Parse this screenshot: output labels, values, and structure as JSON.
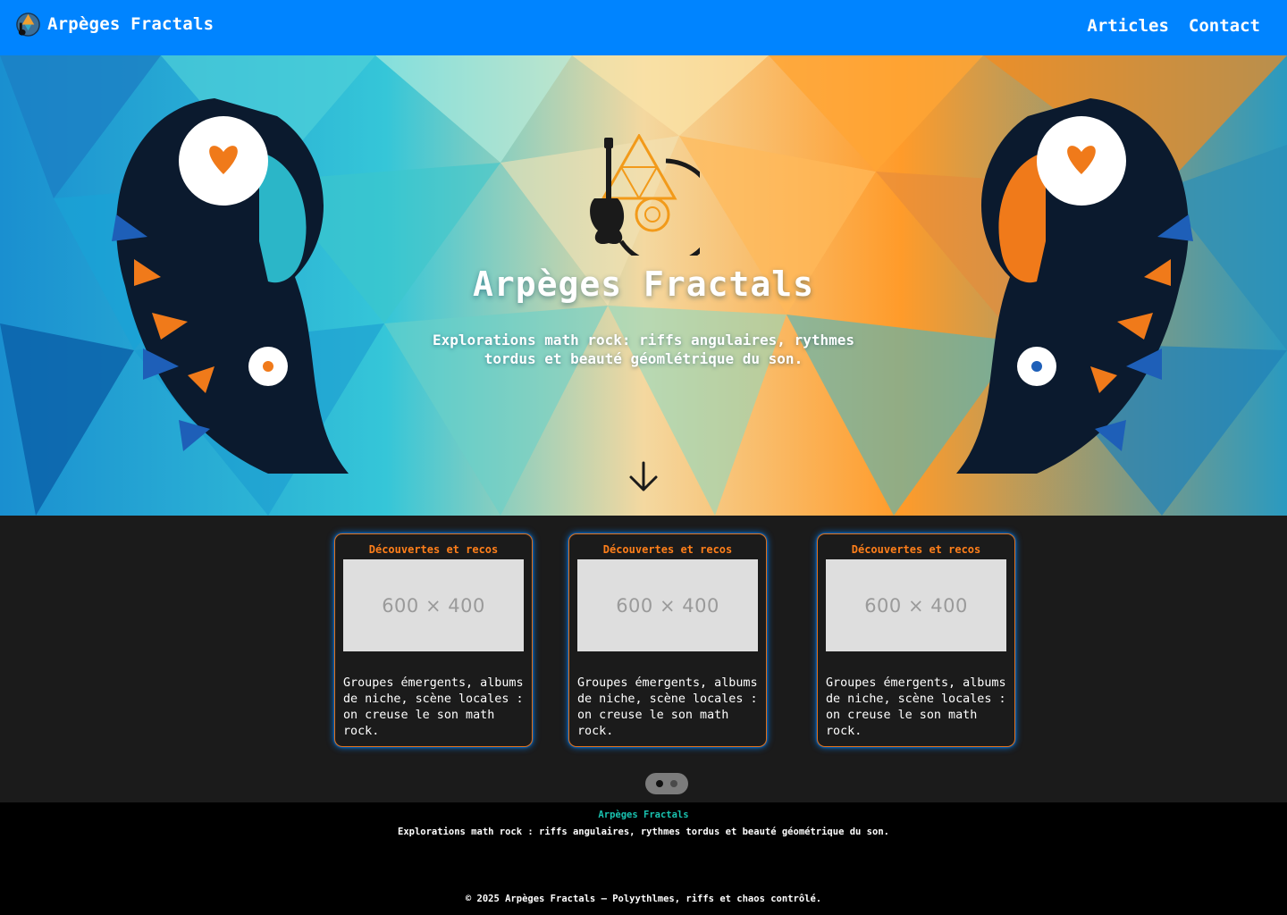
{
  "site": {
    "brand_name": "Arpèges Fractals",
    "accent": "#0084ff",
    "orange": "#ff7f1a",
    "teal": "#19c3b0"
  },
  "nav": {
    "links": [
      {
        "label": "Articles"
      },
      {
        "label": "Contact"
      }
    ]
  },
  "hero": {
    "title": "Arpèges Fractals",
    "subtitle": "Explorations math rock: riffs angulaires, rythmes tordus et beauté géomlétrique du son.",
    "scroll_icon": "arrow-down-icon"
  },
  "cards": [
    {
      "tag": "Découvertes et recos",
      "image_placeholder": "600 × 400",
      "text": "Groupes émergents, albums de niche, scène locales : on creuse le son math rock."
    },
    {
      "tag": "Découvertes et recos",
      "image_placeholder": "600 × 400",
      "text": "Groupes émergents, albums de niche, scène locales : on creuse le son math rock."
    },
    {
      "tag": "Découvertes et recos",
      "image_placeholder": "600 × 400",
      "text": "Groupes émergents, albums de niche, scène locales : on creuse le son math rock."
    }
  ],
  "carousel": {
    "pages": 2,
    "active": 1
  },
  "footer": {
    "title": "Arpèges Fractals",
    "description": "Explorations math rock : riffs angulaires, rythmes tordus et beauté géométrique du son.",
    "copyright": "© 2025 Arpèges Fractals – Polyythlmes, riffs et chaos contrôlé."
  }
}
